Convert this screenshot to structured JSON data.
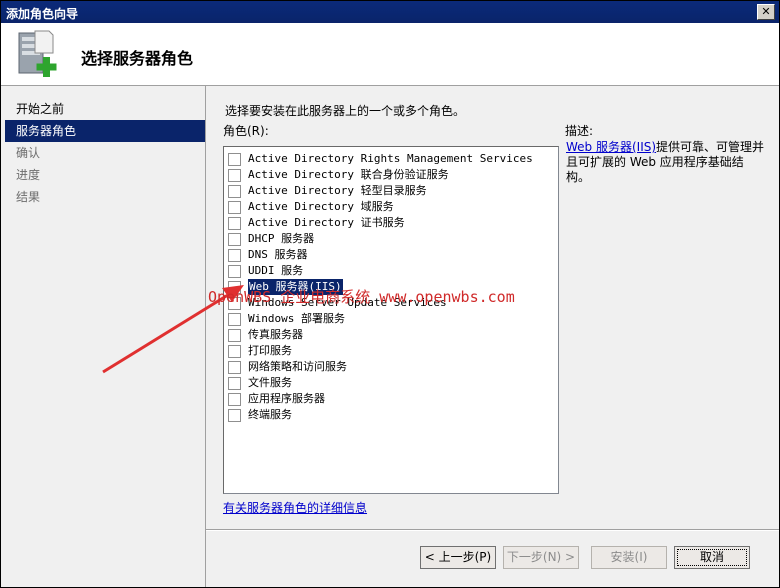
{
  "window": {
    "title": "添加角色向导",
    "close_glyph": "✕"
  },
  "header": {
    "title": "选择服务器角色",
    "icon": "server-add-icon"
  },
  "sidebar": {
    "items": [
      {
        "label": "开始之前",
        "state": "normal"
      },
      {
        "label": "服务器角色",
        "state": "active"
      },
      {
        "label": "确认",
        "state": "dim"
      },
      {
        "label": "进度",
        "state": "dim"
      },
      {
        "label": "结果",
        "state": "dim"
      }
    ]
  },
  "main": {
    "instruction": "选择要安装在此服务器上的一个或多个角色。",
    "roles_label": "角色(R):",
    "roles": [
      {
        "label": "Active Directory Rights Management Services",
        "checked": false
      },
      {
        "label": "Active Directory 联合身份验证服务",
        "checked": false
      },
      {
        "label": "Active Directory 轻型目录服务",
        "checked": false
      },
      {
        "label": "Active Directory 域服务",
        "checked": false
      },
      {
        "label": "Active Directory 证书服务",
        "checked": false
      },
      {
        "label": "DHCP 服务器",
        "checked": false
      },
      {
        "label": "DNS 服务器",
        "checked": false
      },
      {
        "label": "UDDI 服务",
        "checked": false
      },
      {
        "label": "Web 服务器(IIS)",
        "checked": false,
        "selected": true
      },
      {
        "label": "Windows Server Update Services",
        "checked": false
      },
      {
        "label": "Windows 部署服务",
        "checked": false
      },
      {
        "label": "传真服务器",
        "checked": false
      },
      {
        "label": "打印服务",
        "checked": false
      },
      {
        "label": "网络策略和访问服务",
        "checked": false
      },
      {
        "label": "文件服务",
        "checked": false
      },
      {
        "label": "应用程序服务器",
        "checked": false
      },
      {
        "label": "终端服务",
        "checked": false
      }
    ],
    "description_label": "描述:",
    "description_link": "Web 服务器(IIS)",
    "description_text": "提供可靠、可管理并且可扩展的 Web 应用程序基础结构。",
    "more_info_link": "有关服务器角色的详细信息"
  },
  "buttons": {
    "prev": "< 上一步(P)",
    "next": "下一步(N) >",
    "install": "安装(I)",
    "cancel": "取消"
  },
  "watermark": "OpenWBS 企业电商系统 www.openwbs.com",
  "colors": {
    "title_bar": "#0a246a",
    "selection": "#0a246a",
    "link": "#0000cc",
    "annotation": "#e03030"
  }
}
